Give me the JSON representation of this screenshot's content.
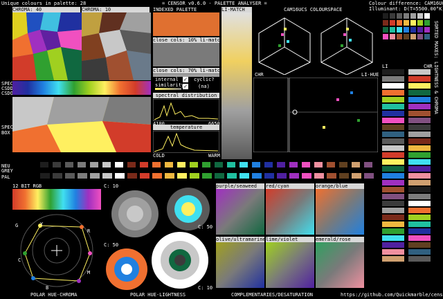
{
  "header": {
    "unique_colours": "Unique colours in palette: 28",
    "app_title": "= CENSOR v0.6.0 - PALETTE ANALYSER =",
    "colour_difference": "Colour difference: CAM16UCS",
    "illuminant": "Illuminant: D(T=5500.00°K)"
  },
  "labels": {
    "chroma40": "CHROMA: 40",
    "chroma10": "CHROMA: 10",
    "indexed_palette": "INDEXED PALETTE",
    "limatch": "LI-MATCH",
    "cam16_space": "CAM16UCS COLOURSPACE",
    "close_10": "close cols: 10% li-match",
    "close_70": "close cols: 70% li-match",
    "internal_similarity": "internal similarity",
    "cyclic": "cyclic?",
    "na": "(na)",
    "spectral_distribution": "spectral distribution",
    "spec_min": "4100",
    "spec_max": "6650",
    "temperature": "temperature",
    "cold": "COLD",
    "warm": "WARM",
    "chr": "CHR",
    "li_hue": "LI-HUE",
    "li": "LI",
    "chr2": "CHR",
    "pal_side": "PAL",
    "neu": "NEU",
    "grey": "GREY",
    "spec": "SPEC",
    "csdd": "CSDD",
    "csdo": "CSDO",
    "spec_box": "SPEC BOX",
    "bit12": "12 BIT RGB",
    "c10a": "C: 10",
    "c50a": "C: 50",
    "c50b": "C: 50",
    "c10b": "C: 10",
    "purple_seaweed": "purple/seaweed",
    "red_cyan": "red/cyan",
    "orange_blue": "orange/blue",
    "olive_ultramarine": "olive/ultramarine",
    "lime_violet": "lime/violet",
    "emerald_rose": "emerald/rose",
    "polar_hue_chroma": "POLAR HUE-CHROMA",
    "polar_hue_lightness": "POLAR HUE-LIGHTNESS",
    "complementaries": "COMPLEMENTARIES/DESATURATION",
    "github": "https://github.com/Quickmarble/censor",
    "vertical_right": "SORTED MAXES: LIGHTNESS & CHROMA",
    "wheel_r": "R",
    "wheel_y": "Y",
    "wheel_g": "G",
    "wheel_c": "C",
    "wheel_b": "B",
    "wheel_m": "M"
  },
  "colors": {
    "bg": "#000000",
    "panel": "#7a7a7a",
    "bar": "#d8d8d8",
    "accent": "#e07030"
  },
  "palette": [
    "#1e1e1e",
    "#3b3b3b",
    "#5a5a5a",
    "#7c7c7c",
    "#a0a0a0",
    "#c8c8c8",
    "#ffffff",
    "#7a2a1a",
    "#d23c2a",
    "#f07030",
    "#f0b840",
    "#fff060",
    "#a0d020",
    "#30a030",
    "#106840",
    "#20c0a0",
    "#40e0f0",
    "#2080e0",
    "#2030a0",
    "#5020a0",
    "#a030c0",
    "#f050c0",
    "#f090a0",
    "#a05030",
    "#604020",
    "#d0a070",
    "#805080",
    "#306080"
  ],
  "icons": {
    "checkbox": "check-icon",
    "target": "crosshair-icon"
  }
}
